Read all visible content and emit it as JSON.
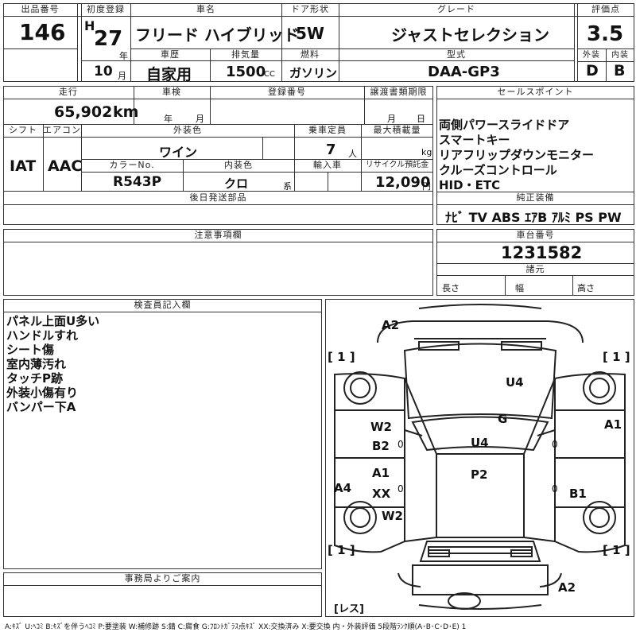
{
  "header_labels": {
    "lot_no": "出品番号",
    "first_reg": "初度登録",
    "car_name": "車名",
    "door": "ドア形状",
    "grade": "グレード",
    "score": "評価点",
    "history": "車歴",
    "displacement": "排気量",
    "fuel": "燃料",
    "model": "型式",
    "exterior": "外装",
    "interior": "内装"
  },
  "lot_no": "146",
  "era": "H",
  "year": "27",
  "year_unit": "年",
  "month": "10",
  "month_unit": "月",
  "car_name": "フリード ハイブリッド",
  "door": "5W",
  "grade": "ジャストセレクション",
  "score": "3.5",
  "history": "自家用",
  "displacement": "1500",
  "displacement_unit": "CC",
  "fuel": "ガソリン",
  "model": "DAA-GP3",
  "exterior_score": "D",
  "interior_score": "B",
  "row2_labels": {
    "mileage": "走行",
    "inspection": "車検",
    "reg_no": "登録番号",
    "transfer": "譲渡書類期限",
    "sales_point": "セールスポイント",
    "shift": "シフト",
    "aircon": "エアコン",
    "ext_color": "外装色",
    "capacity": "乗車定員",
    "max_load": "最大積載量",
    "color_no": "カラーNo.",
    "int_color": "内装色",
    "import": "輸入車",
    "recycle": "リサイクル預託金",
    "later_parts": "後日発送部品",
    "equipment": "純正装備",
    "caution": "注意事項欄",
    "chassis_no": "車台番号",
    "dimensions": "諸元",
    "inspector": "検査員記入欄",
    "office": "事務局よりご案内"
  },
  "mileage": "65,902",
  "mileage_unit": "km",
  "insp_year": "年",
  "insp_month": "月",
  "transfer_month": "月",
  "transfer_day": "日",
  "shift": "IAT",
  "aircon": "AAC",
  "ext_color": "ワイン",
  "capacity": "7",
  "capacity_unit": "人",
  "load_unit": "kg",
  "color_no": "R543P",
  "int_color": "クロ",
  "int_color_unit": "系",
  "recycle": "12,090",
  "recycle_unit": "円",
  "sales_points": [
    "両側パワースライドドア",
    "スマートキー",
    "リアフリップダウンモニター",
    "クルーズコントロール",
    "HID・ETC"
  ],
  "equipment": "ﾅﾋﾞ  TV  ABS ｴｱB ｱﾙﾐ PS PW",
  "chassis_no": "1231582",
  "dim_length": "長さ",
  "dim_width": "幅",
  "dim_height": "高さ",
  "inspector_notes": [
    "パネル上面U多い",
    "ハンドルすれ",
    "シート傷",
    "室内薄汚れ",
    "タッチP跡",
    "外装小傷有り",
    "バンパー下A"
  ],
  "diagram_marks": {
    "front_bumper": "A2",
    "hood": "U4",
    "windshield": "G",
    "roof": "U4",
    "rear_roof": "P2",
    "left_front_door": "W2",
    "left_front_door2": "B2",
    "left_rear_door": "A1",
    "left_rear_door2": "XX",
    "left_rear": "W2",
    "right_front": "A1",
    "right_rear": "B1",
    "left_side": "A4",
    "rear_bumper": "A2",
    "tire_fl": "1",
    "tire_fr": "1",
    "tire_rl": "1",
    "tire_rr": "1",
    "zero1": "0",
    "zero2": "0",
    "zero3": "0",
    "zero4": "0",
    "bottom_label": "レス"
  },
  "legend": "A:ｷｽﾞ U:ﾍｺﾐ B:ｷｽﾞを伴うﾍｺﾐ P:要塗装 W:補修跡 S:錆 C:腐食 G:ﾌﾛﾝﾄｶﾞﾗｽ点ｷｽﾞ XX:交換済み X:要交換  内・外装評価 5段階ﾗﾝｸ順(A･B･C･D･E) 1"
}
